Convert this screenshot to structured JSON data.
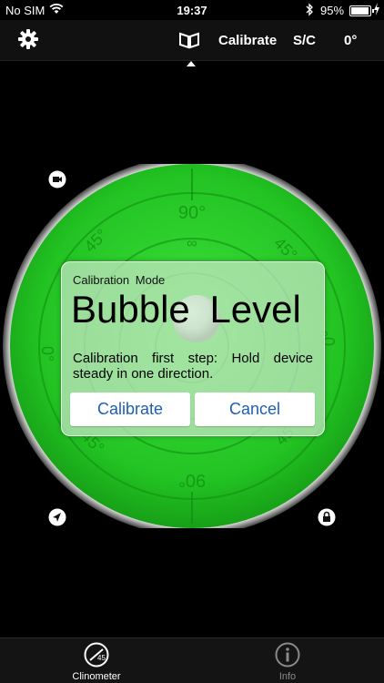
{
  "status_bar": {
    "carrier": "No SIM",
    "time": "19:37",
    "battery_percent": "95%",
    "battery_level": 0.95
  },
  "toolbar": {
    "calibrate_label": "Calibrate",
    "sc_label": "S/C",
    "angle_label": "0°"
  },
  "level": {
    "labels_90": "90°",
    "labels_45": "45°",
    "labels_0": "0°",
    "labels_inf": "∞"
  },
  "dialog": {
    "mode_label": "Calibration Mode",
    "title": "Bubble Level",
    "message": "Calibration first step: Hold device steady in one direction.",
    "calibrate_button": "Calibrate",
    "cancel_button": "Cancel"
  },
  "tabs": [
    {
      "label": "Clinometer",
      "icon": "clinometer-icon",
      "active": true
    },
    {
      "label": "Info",
      "icon": "info-icon",
      "active": false
    }
  ],
  "colors": {
    "level_green": "#22c322",
    "button_text": "#1d5fb5"
  }
}
